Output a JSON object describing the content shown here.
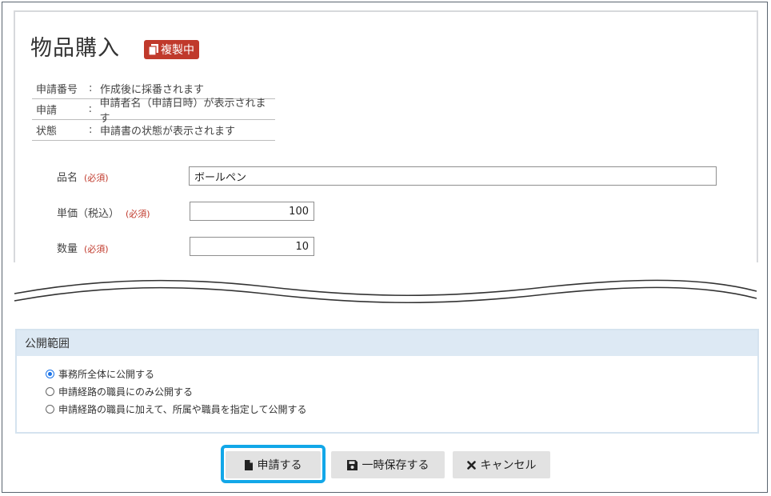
{
  "header": {
    "title": "物品購入",
    "badge": "複製中"
  },
  "info": [
    {
      "label": "申請番号",
      "sep": ":",
      "value": "作成後に採番されます"
    },
    {
      "label": "申請",
      "sep": ":",
      "value": "申請者名（申請日時）が表示されます"
    },
    {
      "label": "状態",
      "sep": ":",
      "value": "申請書の状態が表示されます"
    }
  ],
  "form": {
    "item_name": {
      "label": "品名",
      "required": "(必須)",
      "value": "ボールペン"
    },
    "unit_price": {
      "label": "単価（税込）",
      "required": "(必須)",
      "value": "100"
    },
    "quantity": {
      "label": "数量",
      "required": "(必須)",
      "value": "10"
    }
  },
  "scope": {
    "title": "公開範囲",
    "options": [
      {
        "label": "事務所全体に公開する",
        "checked": true
      },
      {
        "label": "申請経路の職員にのみ公開する",
        "checked": false
      },
      {
        "label": "申請経路の職員に加えて、所属や職員を指定して公開する",
        "checked": false
      }
    ]
  },
  "buttons": {
    "submit": "申請する",
    "save_draft": "一時保存する",
    "cancel": "キャンセル"
  },
  "colors": {
    "badge": "#c0392b",
    "required": "#c0392b",
    "scope_header": "#dde9f4",
    "highlight": "#12a7e8",
    "radio_checked": "#1a73e8"
  }
}
